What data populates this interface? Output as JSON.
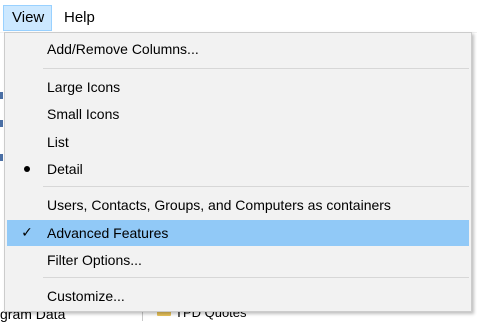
{
  "menubar": {
    "items": [
      {
        "label": "View"
      },
      {
        "label": "Help"
      }
    ]
  },
  "menu": {
    "items": [
      {
        "label": "Add/Remove Columns...",
        "mark": ""
      },
      {
        "label": "Large Icons",
        "mark": ""
      },
      {
        "label": "Small Icons",
        "mark": ""
      },
      {
        "label": "List",
        "mark": ""
      },
      {
        "label": "Detail",
        "mark": "bullet"
      },
      {
        "label": "Users, Contacts, Groups, and Computers as containers",
        "mark": ""
      },
      {
        "label": "Advanced Features",
        "mark": "check",
        "highlighted": true
      },
      {
        "label": "Filter Options...",
        "mark": ""
      },
      {
        "label": "Customize...",
        "mark": ""
      }
    ]
  },
  "background": {
    "left_text": "gram Data",
    "right_text": "TPD Quotes"
  },
  "colors": {
    "menu_background": "#f2f2f2",
    "highlight": "#91c9f7",
    "active_menubar": "#cce8ff"
  }
}
